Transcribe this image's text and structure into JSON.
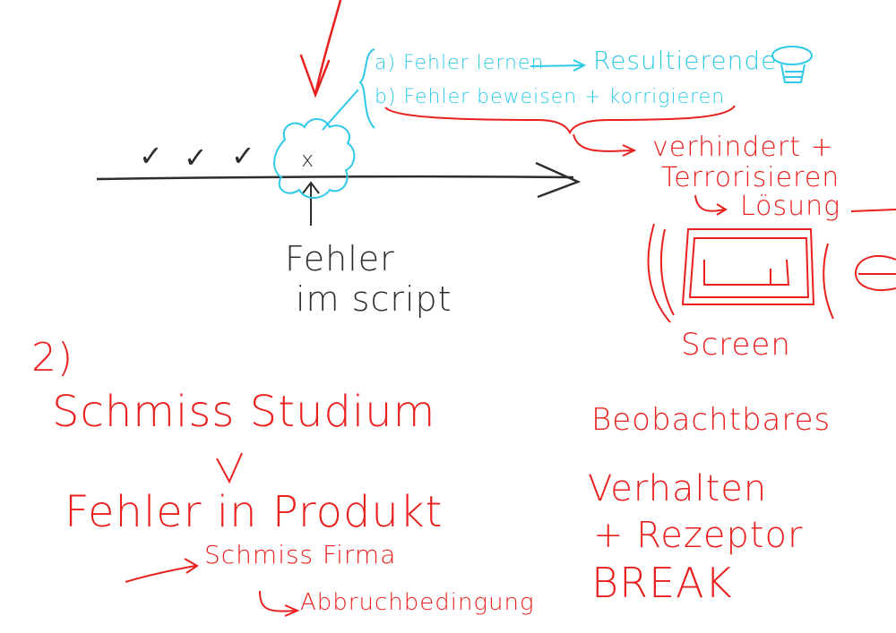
{
  "colors": {
    "red": "#e8211f",
    "cyan": "#2ec9e8",
    "dark": "#2d2d2d"
  },
  "timeline": {
    "marks": [
      "✓",
      "✓",
      "✓",
      "x"
    ],
    "error_label_line1": "Fehler",
    "error_label_line2": "im script"
  },
  "notes": {
    "item_a": "a) Fehler lernen",
    "item_a_result": "Resultierende",
    "item_b": "b) Fehler beweisen + korrigieren",
    "prevents": "verhindert +",
    "terrorize": "Terrorisieren",
    "solution": "Lösung",
    "screen_label": "Screen"
  },
  "section2": {
    "number": "2)",
    "line1": "Schmiss Studium",
    "line2": "Fehler in Produkt",
    "line3": "Schmiss Firma",
    "line4": "Abbruchbedingung"
  },
  "observable": {
    "line1": "Beobachtbares",
    "line2": "Verhalten",
    "line3": "+ Rezeptor",
    "line4": "BREAK"
  },
  "icons": [
    "lightbulb-icon"
  ]
}
